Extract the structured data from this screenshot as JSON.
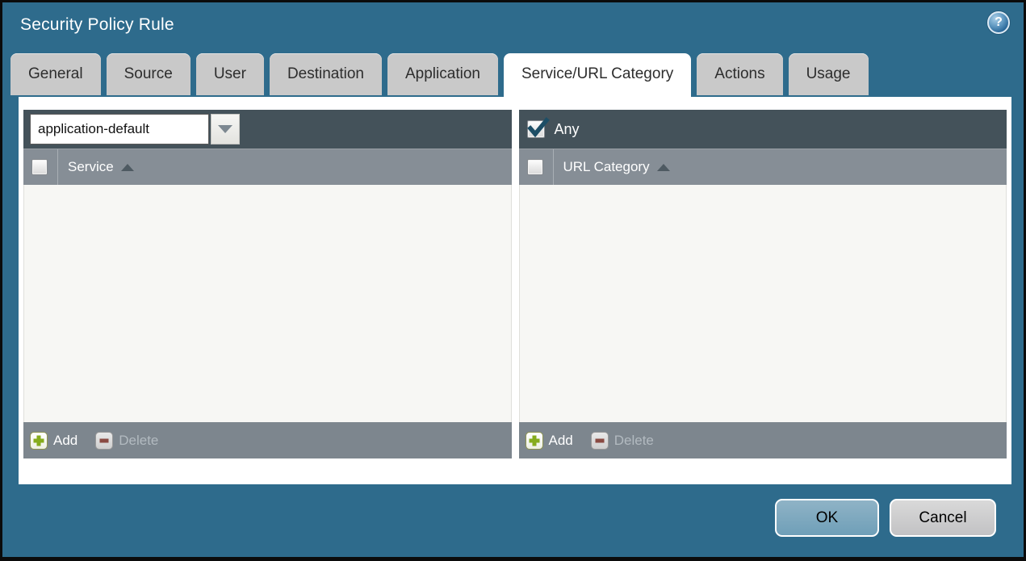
{
  "window": {
    "title": "Security Policy Rule"
  },
  "tabs": [
    {
      "label": "General",
      "active": false
    },
    {
      "label": "Source",
      "active": false
    },
    {
      "label": "User",
      "active": false
    },
    {
      "label": "Destination",
      "active": false
    },
    {
      "label": "Application",
      "active": false
    },
    {
      "label": "Service/URL Category",
      "active": true
    },
    {
      "label": "Actions",
      "active": false
    },
    {
      "label": "Usage",
      "active": false
    }
  ],
  "service_panel": {
    "mode_dropdown": {
      "value": "application-default"
    },
    "select_all_checked": false,
    "column_header": {
      "label": "Service",
      "sort": "asc"
    },
    "rows": [],
    "toolbar": {
      "add_label": "Add",
      "delete_label": "Delete",
      "add_enabled": true,
      "delete_enabled": false
    }
  },
  "url_category_panel": {
    "any_checkbox": {
      "label": "Any",
      "checked": true
    },
    "select_all_checked": false,
    "column_header": {
      "label": "URL Category",
      "sort": "asc"
    },
    "rows": [],
    "toolbar": {
      "add_label": "Add",
      "delete_label": "Delete",
      "add_enabled": true,
      "delete_enabled": false
    }
  },
  "footer": {
    "ok_label": "OK",
    "cancel_label": "Cancel"
  },
  "icons": {
    "help": "?",
    "dropdown_arrow": "chevron-down",
    "sort": "triangle-up",
    "add": "plus",
    "delete": "minus",
    "checked": "checkmark"
  },
  "colors": {
    "titlebar_background": "#2e6b8c",
    "panel_toolbar": "#44525a",
    "column_header": "#868e96",
    "panel_footer": "#7d868e",
    "panel_body": "#f7f7f4",
    "tab_inactive": "#c9c9c9",
    "tab_active": "#ffffff",
    "ok_button": "#7ba7bd",
    "cancel_button": "#cccccc",
    "add_icon_green": "#86ac1d",
    "delete_icon_red": "#8a4a42",
    "check_mark": "#1d4e66"
  }
}
